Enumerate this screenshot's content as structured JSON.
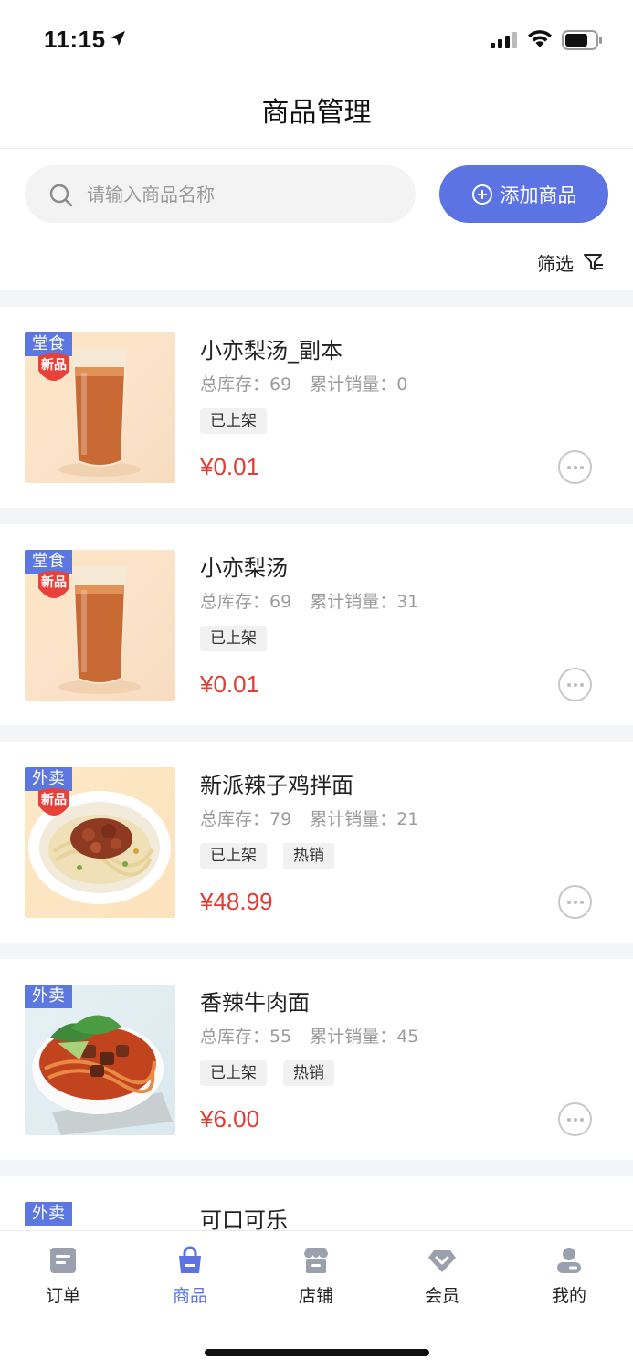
{
  "status_bar": {
    "time": "11:15"
  },
  "header": {
    "title": "商品管理"
  },
  "search": {
    "placeholder": "请输入商品名称"
  },
  "actions": {
    "add_label": "添加商品",
    "filter_label": "筛选"
  },
  "colors": {
    "accent": "#5b73e3",
    "price": "#e03c31",
    "service_tag": "#5c77e0"
  },
  "products": [
    {
      "name": "小亦梨汤_副本",
      "service": "堂食",
      "new_badge": "新品",
      "stock_label": "总库存：69",
      "sales_label": "累计销量：0",
      "tags": [
        "已上架"
      ],
      "price": "¥0.01",
      "image": "juice"
    },
    {
      "name": "小亦梨汤",
      "service": "堂食",
      "new_badge": "新品",
      "stock_label": "总库存：69",
      "sales_label": "累计销量：31",
      "tags": [
        "已上架"
      ],
      "price": "¥0.01",
      "image": "juice"
    },
    {
      "name": "新派辣子鸡拌面",
      "service": "外卖",
      "new_badge": "新品",
      "stock_label": "总库存：79",
      "sales_label": "累计销量：21",
      "tags": [
        "已上架",
        "热销"
      ],
      "price": "¥48.99",
      "image": "chicken-noodle"
    },
    {
      "name": "香辣牛肉面",
      "service": "外卖",
      "new_badge": "",
      "stock_label": "总库存：55",
      "sales_label": "累计销量：45",
      "tags": [
        "已上架",
        "热销"
      ],
      "price": "¥6.00",
      "image": "beef-noodle"
    },
    {
      "name": "可口可乐",
      "service": "外卖",
      "new_badge": "",
      "stock_label": "",
      "sales_label": "",
      "tags": [],
      "price": "",
      "image": "cola"
    }
  ],
  "tabs": [
    {
      "label": "订单",
      "icon": "order-icon",
      "active": false
    },
    {
      "label": "商品",
      "icon": "bag-icon",
      "active": true
    },
    {
      "label": "店铺",
      "icon": "store-icon",
      "active": false
    },
    {
      "label": "会员",
      "icon": "diamond-icon",
      "active": false
    },
    {
      "label": "我的",
      "icon": "user-icon",
      "active": false
    }
  ]
}
